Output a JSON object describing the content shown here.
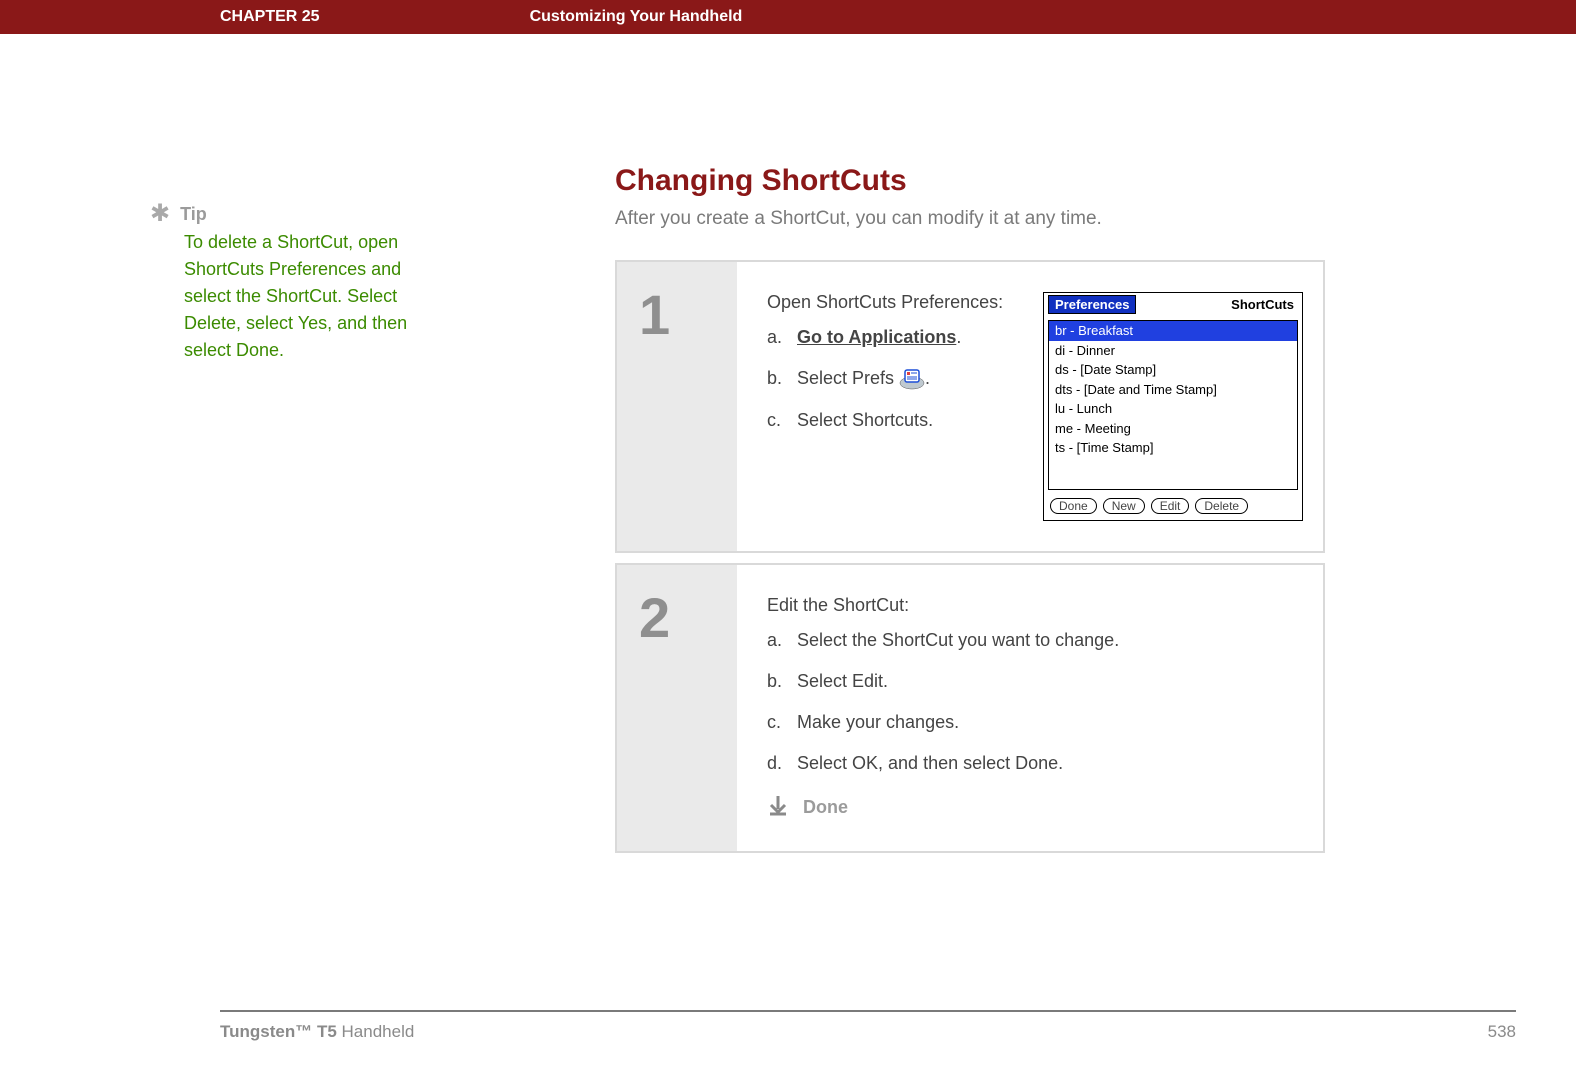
{
  "header": {
    "chapter": "CHAPTER 25",
    "title": "Customizing Your Handheld"
  },
  "sidebar": {
    "tip_label": "Tip",
    "tip_body": "To delete a ShortCut, open ShortCuts Preferences and select the ShortCut. Select Delete, select Yes, and then select Done."
  },
  "content": {
    "title": "Changing ShortCuts",
    "subtitle": "After you create a ShortCut, you can modify it at any time."
  },
  "steps": {
    "s1": {
      "num": "1",
      "heading": "Open ShortCuts Preferences:",
      "a_pre": "a.",
      "a_link": "Go to Applications",
      "a_post": ".",
      "b_pre": "b.",
      "b_text": "Select Prefs ",
      "b_post": ".",
      "c_pre": "c.",
      "c_text": "Select Shortcuts."
    },
    "s2": {
      "num": "2",
      "heading": "Edit the ShortCut:",
      "a_pre": "a.",
      "a_text": "Select the ShortCut you want to change.",
      "b_pre": "b.",
      "b_text": "Select Edit.",
      "c_pre": "c.",
      "c_text": "Make your changes.",
      "d_pre": "d.",
      "d_text": "Select OK, and then select Done.",
      "done": "Done"
    }
  },
  "palm": {
    "title_left": "Preferences",
    "title_right": "ShortCuts",
    "items": {
      "i0": "br - Breakfast",
      "i1": "di - Dinner",
      "i2": "ds - [Date Stamp]",
      "i3": "dts - [Date and Time Stamp]",
      "i4": "lu - Lunch",
      "i5": "me - Meeting",
      "i6": "ts - [Time Stamp]"
    },
    "buttons": {
      "done": "Done",
      "new": "New",
      "edit": "Edit",
      "delete": "Delete"
    }
  },
  "footer": {
    "product_bold": "Tungsten™ T5",
    "product_rest": " Handheld",
    "page": "538"
  }
}
